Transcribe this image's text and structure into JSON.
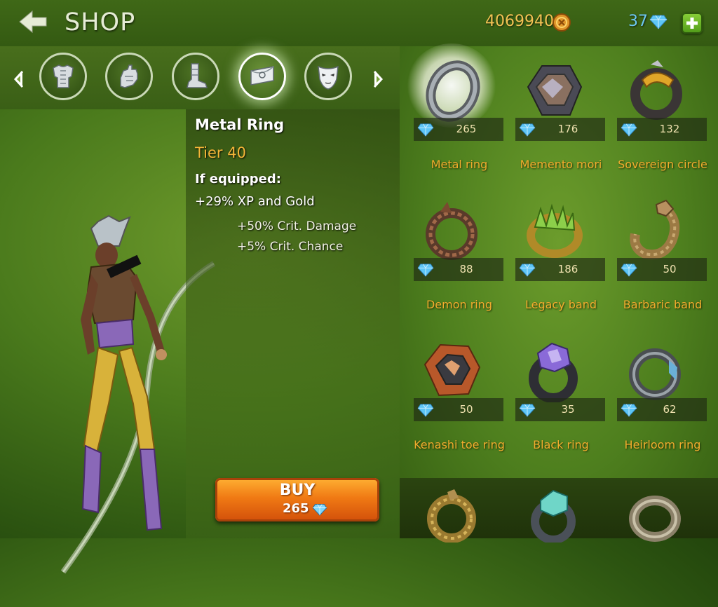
{
  "header": {
    "title": "SHOP",
    "gold": "4069940",
    "gems": "37"
  },
  "categories": [
    {
      "icon": "armor-icon"
    },
    {
      "icon": "gauntlet-icon"
    },
    {
      "icon": "boot-icon"
    },
    {
      "icon": "ring-icon",
      "selected": true
    },
    {
      "icon": "mask-icon"
    }
  ],
  "details": {
    "name": "Metal Ring",
    "tier": "Tier 40",
    "equipped_label": "If equipped:",
    "stats": [
      "+29% XP and Gold",
      "+50% Crit. Damage",
      "+5% Crit. Chance"
    ]
  },
  "buy": {
    "label": "BUY",
    "price": "265"
  },
  "items": [
    {
      "name": "Metal ring",
      "price": "265",
      "selected": true
    },
    {
      "name": "Memento mori",
      "price": "176"
    },
    {
      "name": "Sovereign circle",
      "price": "132"
    },
    {
      "name": "Demon ring",
      "price": "88"
    },
    {
      "name": "Legacy band",
      "price": "186"
    },
    {
      "name": "Barbaric band",
      "price": "50"
    },
    {
      "name": "Kenashi toe ring",
      "price": "50"
    },
    {
      "name": "Black ring",
      "price": "35"
    },
    {
      "name": "Heirloom ring",
      "price": "62"
    }
  ],
  "colors": {
    "gold_text": "#f3c354",
    "gem_text": "#6ec8f4",
    "item_name": "#f2ac2e",
    "tier": "#f5b638",
    "buy_button": "#f07a14"
  }
}
